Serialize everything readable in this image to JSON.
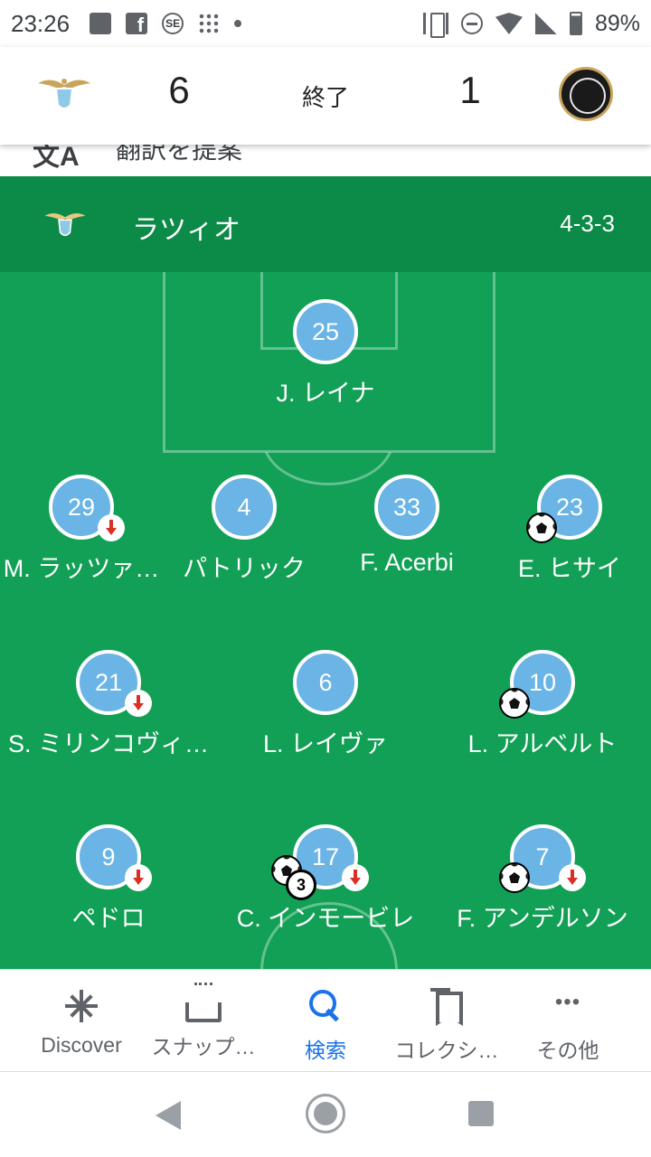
{
  "status_bar": {
    "time": "23:26",
    "battery": "89%",
    "left_icons": [
      "image-icon",
      "facebook-icon",
      "se-app-icon",
      "dots-grid-icon",
      "notification-dot-icon"
    ],
    "right_icons": [
      "vibrate-icon",
      "do-not-disturb-icon",
      "wifi-icon",
      "signal-icon",
      "battery-icon"
    ]
  },
  "match": {
    "home_score": "6",
    "status": "終了",
    "away_score": "1",
    "home_crest": "lazio-crest-icon",
    "away_crest": "spezia-crest-icon"
  },
  "peek_row": {
    "icon": "translate-icon",
    "icon_text": "文A",
    "text": "翻訳を提案"
  },
  "team": {
    "name": "ラツィオ",
    "formation": "4-3-3",
    "crest": "lazio-crest-icon"
  },
  "colors": {
    "pitch": "#11a055",
    "team_bar": "#0c8a47",
    "player_circle": "#6ab4e6",
    "sub_arrow": "#d93025",
    "active_nav": "#1a73e8"
  },
  "lineup": {
    "goalkeeper": [
      {
        "number": "25",
        "name": "J. レイナ",
        "subbed_off": false,
        "goals": 0
      }
    ],
    "defenders": [
      {
        "number": "29",
        "name": "M. ラッツァ…",
        "subbed_off": true,
        "goals": 0
      },
      {
        "number": "4",
        "name": "パトリック",
        "subbed_off": false,
        "goals": 0
      },
      {
        "number": "33",
        "name": "F. Acerbi",
        "subbed_off": false,
        "goals": 0
      },
      {
        "number": "23",
        "name": "E. ヒサイ",
        "subbed_off": false,
        "goals": 1
      }
    ],
    "midfielders": [
      {
        "number": "21",
        "name": "S. ミリンコヴィ…",
        "subbed_off": true,
        "goals": 0
      },
      {
        "number": "6",
        "name": "L. レイヴァ",
        "subbed_off": false,
        "goals": 0
      },
      {
        "number": "10",
        "name": "L. アルベルト",
        "subbed_off": false,
        "goals": 1
      }
    ],
    "forwards": [
      {
        "number": "9",
        "name": "ペドロ",
        "subbed_off": true,
        "goals": 0
      },
      {
        "number": "17",
        "name": "C. インモービレ",
        "subbed_off": true,
        "goals": 3,
        "goal_count_label": "3"
      },
      {
        "number": "7",
        "name": "F. アンデルソン",
        "subbed_off": true,
        "goals": 1
      }
    ]
  },
  "bottom_nav": [
    {
      "label": "Discover",
      "icon": "discover-icon",
      "active": false
    },
    {
      "label": "スナップ…",
      "icon": "snapshot-icon",
      "active": false
    },
    {
      "label": "検索",
      "icon": "search-icon",
      "active": true
    },
    {
      "label": "コレクシ…",
      "icon": "collections-icon",
      "active": false
    },
    {
      "label": "その他",
      "icon": "more-icon",
      "active": false
    }
  ],
  "system_nav": [
    "back-icon",
    "home-icon",
    "recents-icon"
  ]
}
